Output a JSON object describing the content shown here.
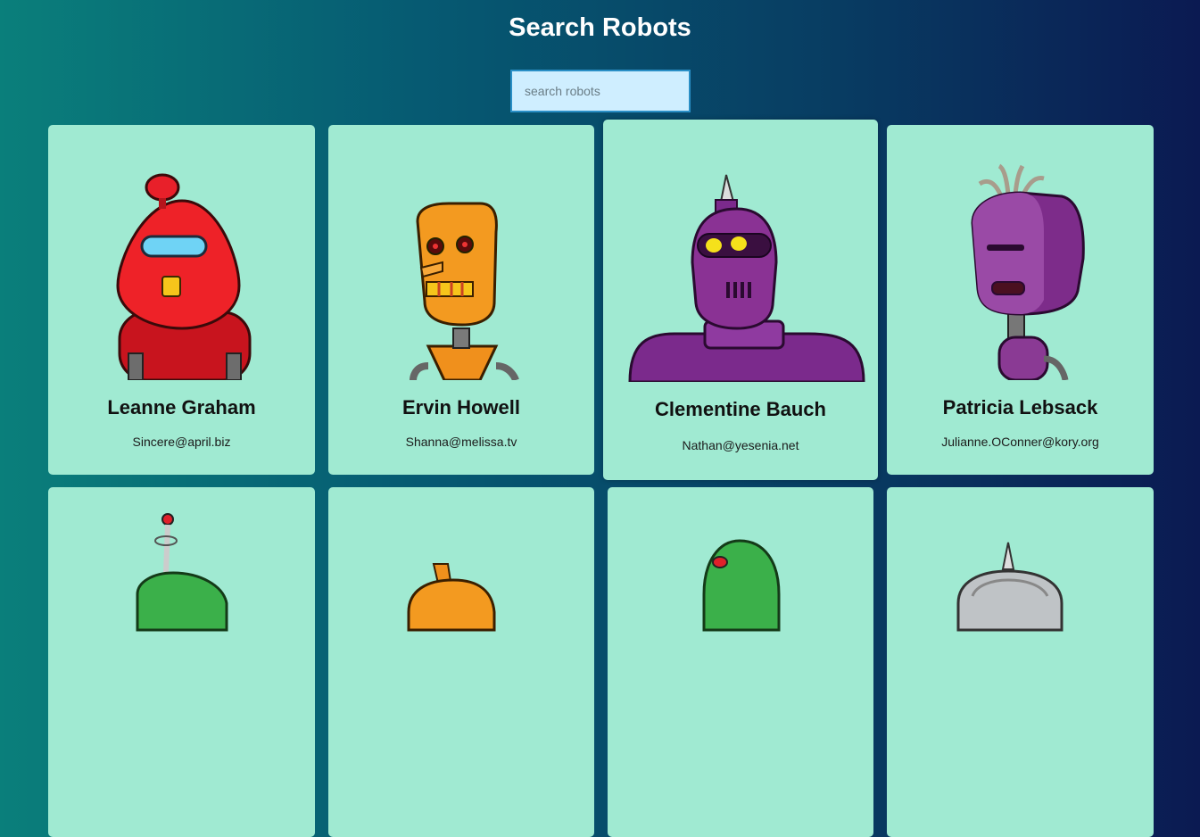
{
  "header": {
    "title": "Search Robots"
  },
  "search": {
    "placeholder": "search robots",
    "value": ""
  },
  "robots": [
    {
      "name": "Leanne Graham",
      "email": "Sincere@april.biz",
      "icon": "red-robot-avatar",
      "color": "#e8202a"
    },
    {
      "name": "Ervin Howell",
      "email": "Shanna@melissa.tv",
      "icon": "orange-robot-avatar",
      "color": "#f0901c"
    },
    {
      "name": "Clementine Bauch",
      "email": "Nathan@yesenia.net",
      "icon": "purple-robot-avatar",
      "color": "#7b2a8c",
      "state": "hovered"
    },
    {
      "name": "Patricia Lebsack",
      "email": "Julianne.OConner@kory.org",
      "icon": "purple-robot-avatar",
      "color": "#8a3a94"
    },
    {
      "name": "",
      "email": "",
      "icon": "green-robot-avatar",
      "color": "#3bb04a"
    },
    {
      "name": "",
      "email": "",
      "icon": "orange-robot-avatar",
      "color": "#f0901c"
    },
    {
      "name": "",
      "email": "",
      "icon": "green-robot-avatar",
      "color": "#3bb04a"
    },
    {
      "name": "",
      "email": "",
      "icon": "grey-robot-avatar",
      "color": "#bfc3c6"
    }
  ],
  "colors": {
    "card_bg": "#a0ead2",
    "search_bg": "#cfeeff",
    "search_border": "#2a8fc6"
  }
}
